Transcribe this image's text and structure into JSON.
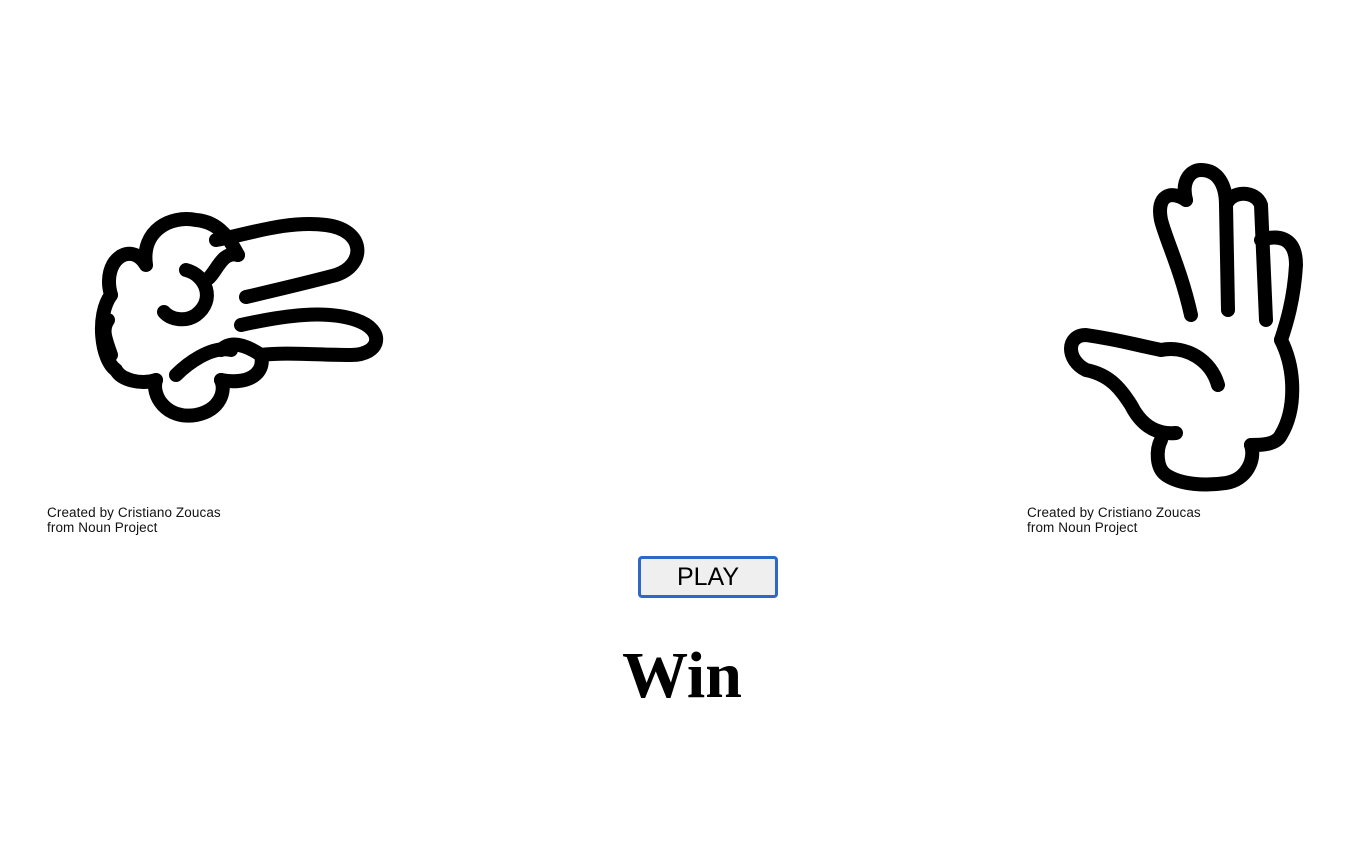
{
  "player_hand": {
    "icon": "scissors-hand-icon",
    "credit_line1": "Created by Cristiano Zoucas",
    "credit_line2": "from Noun Project"
  },
  "computer_hand": {
    "icon": "paper-hand-icon",
    "credit_line1": "Created by Cristiano Zoucas",
    "credit_line2": "from Noun Project"
  },
  "controls": {
    "play_label": "PLAY"
  },
  "result": {
    "text": "Win"
  },
  "colors": {
    "button_border": "#2f67c5",
    "button_bg": "#efefef"
  }
}
